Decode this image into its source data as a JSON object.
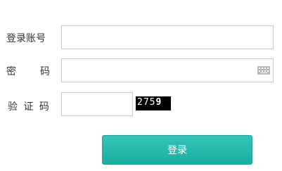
{
  "form": {
    "account": {
      "label": "登录账号",
      "value": "",
      "placeholder": ""
    },
    "password": {
      "label": "密　　码",
      "value": "",
      "placeholder": "",
      "keyboard_icon": "keyboard-icon"
    },
    "captcha": {
      "label": "验 证 码",
      "value": "",
      "placeholder": "",
      "image_text_main": "275",
      "image_text_last": "9"
    },
    "submit_label": "登录"
  },
  "colors": {
    "button": "#20b2a7",
    "input_border": "#c8c8c8",
    "captcha_bg": "#000000"
  }
}
